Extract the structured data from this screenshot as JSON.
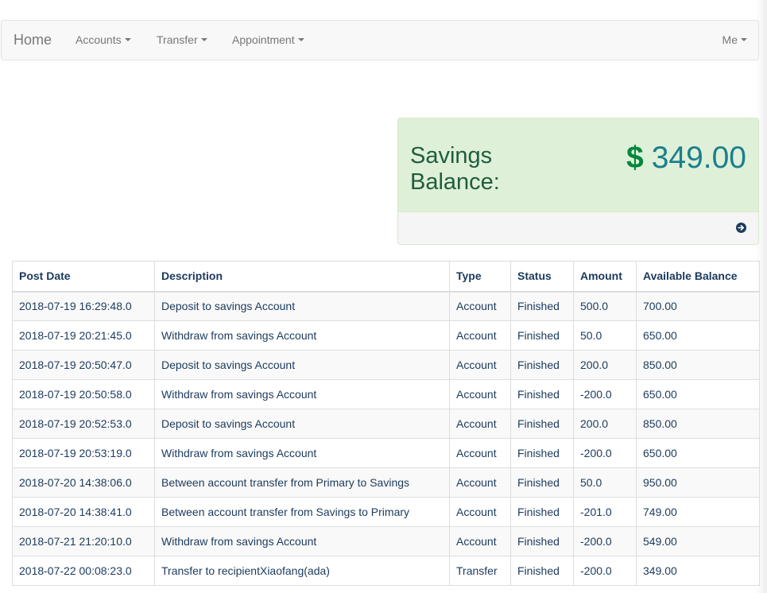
{
  "navbar": {
    "brand": "Home",
    "items": [
      {
        "label": "Accounts"
      },
      {
        "label": "Transfer"
      },
      {
        "label": "Appointment"
      }
    ],
    "user_menu": "Me"
  },
  "balance_panel": {
    "label": "Savings Balance:",
    "currency_symbol": "$",
    "amount": "349.00"
  },
  "transactions": {
    "columns": [
      "Post Date",
      "Description",
      "Type",
      "Status",
      "Amount",
      "Available Balance"
    ],
    "rows": [
      [
        "2018-07-19 16:29:48.0",
        "Deposit to savings Account",
        "Account",
        "Finished",
        "500.0",
        "700.00"
      ],
      [
        "2018-07-19 20:21:45.0",
        "Withdraw from savings Account",
        "Account",
        "Finished",
        "50.0",
        "650.00"
      ],
      [
        "2018-07-19 20:50:47.0",
        "Deposit to savings Account",
        "Account",
        "Finished",
        "200.0",
        "850.00"
      ],
      [
        "2018-07-19 20:50:58.0",
        "Withdraw from savings Account",
        "Account",
        "Finished",
        "-200.0",
        "650.00"
      ],
      [
        "2018-07-19 20:52:53.0",
        "Deposit to savings Account",
        "Account",
        "Finished",
        "200.0",
        "850.00"
      ],
      [
        "2018-07-19 20:53:19.0",
        "Withdraw from savings Account",
        "Account",
        "Finished",
        "-200.0",
        "650.00"
      ],
      [
        "2018-07-20 14:38:06.0",
        "Between account transfer from Primary to Savings",
        "Account",
        "Finished",
        "50.0",
        "950.00"
      ],
      [
        "2018-07-20 14:38:41.0",
        "Between account transfer from Savings to Primary",
        "Account",
        "Finished",
        "-201.0",
        "749.00"
      ],
      [
        "2018-07-21 21:20:10.0",
        "Withdraw from savings Account",
        "Account",
        "Finished",
        "-200.0",
        "549.00"
      ],
      [
        "2018-07-22 00:08:23.0",
        "Transfer to recipientXiaofang(ada)",
        "Transfer",
        "Finished",
        "-200.0",
        "349.00"
      ]
    ]
  }
}
